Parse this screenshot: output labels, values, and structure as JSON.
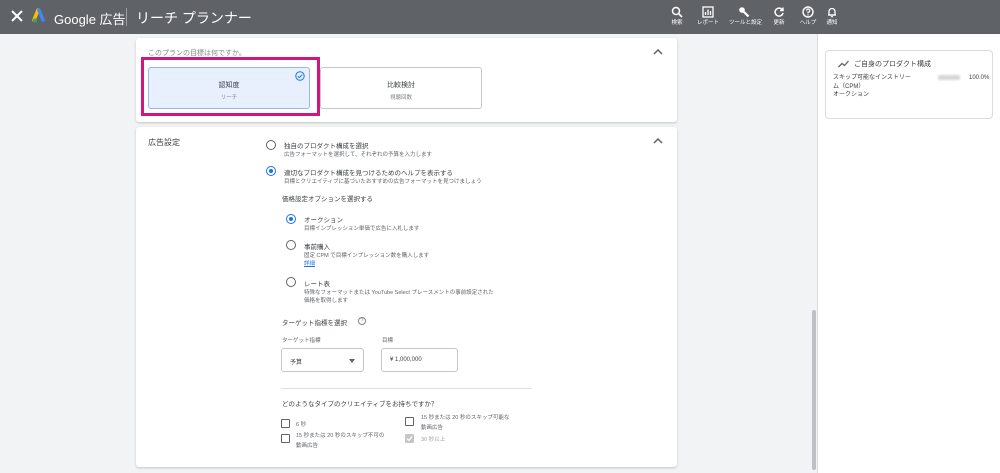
{
  "topbar": {
    "brand": "Google 広告",
    "tool_title": "リーチ プランナー",
    "items": [
      {
        "icon": "search-icon",
        "label": "検索"
      },
      {
        "icon": "report-icon",
        "label": "レポート"
      },
      {
        "icon": "tools-icon",
        "label": "ツールと設定"
      },
      {
        "icon": "refresh-icon",
        "label": "更新"
      },
      {
        "icon": "help-icon",
        "label": "ヘルプ"
      },
      {
        "icon": "bell-icon",
        "label": "通知"
      }
    ]
  },
  "goal_section": {
    "question": "このプランの目標は何ですか。",
    "options": [
      {
        "title": "認知度",
        "sub": "リーチ",
        "selected": true
      },
      {
        "title": "比較検討",
        "sub": "視聴回数",
        "selected": false
      }
    ]
  },
  "ad_settings": {
    "title": "広告設定",
    "option_own": {
      "title": "独自のプロダクト構成を選択",
      "desc": "広告フォーマットを選択して、それぞれの予算を入力します"
    },
    "option_help": {
      "title": "適切なプロダクト構成を見つけるためのヘルプを表示する",
      "desc": "目標とクリエイティブに基づいたおすすめの広告フォーマットを見つけましょう"
    },
    "price_label": "価格設定オプションを選択する",
    "price_options": [
      {
        "title": "オークション",
        "desc": "目標インプレッション単価で広告に入札します"
      },
      {
        "title": "事前購入",
        "desc": "固定 CPM で目標インプレッション数を購入します",
        "link": "詳細"
      },
      {
        "title": "レート表",
        "desc": "特殊なフォーマットまたは YouTube Select プレースメントの事前設定された",
        "desc2": "価格を取得します"
      }
    ],
    "target_label": "ターゲット指標を選択",
    "metric_label": "ターゲット指標",
    "metric_value": "予算",
    "goal_label": "目標",
    "goal_value": "¥ 1,000,000",
    "creative_q": "どのようなタイプのクリエイティブをお持ちですか？",
    "creatives": {
      "c1": "6 秒",
      "c2": "15 秒または 20 秒のスキップ不可の",
      "c2b": "動画広告",
      "c3": "15 秒または 20 秒のスキップ可能な",
      "c3b": "動画広告",
      "c4": "30 秒以上"
    }
  },
  "right_panel": {
    "title": "ご自身のプロダクト構成",
    "line1": "スキップ可能なインストリー",
    "line2": "ム（CPM）",
    "line3": "オークション",
    "pct": "100.0%"
  }
}
